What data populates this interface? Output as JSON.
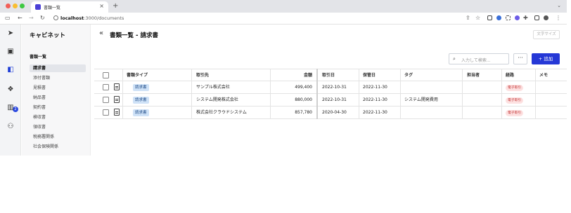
{
  "browser": {
    "tab_title": "書類一覧",
    "url_host": "localhost",
    "url_rest": ":3000/documents"
  },
  "colors": {
    "accent": "#2538d6",
    "tag_type_bg": "#cfe2f7",
    "tag_status_bg": "#fde1e1"
  },
  "sidebar": {
    "app_title": "キャビネット",
    "section_label": "書類一覧",
    "items": [
      {
        "label": "請求書",
        "active": true
      },
      {
        "label": "添付書類"
      },
      {
        "label": "見積書"
      },
      {
        "label": "納品書"
      },
      {
        "label": "契約書"
      },
      {
        "label": "検収書"
      },
      {
        "label": "領収書"
      },
      {
        "label": "税務署関係"
      },
      {
        "label": "社会保険関係"
      }
    ],
    "rail_badge": "2"
  },
  "main": {
    "title": "書類一覧 - 請求書",
    "font_size_button": "文字サイズ",
    "search_placeholder": "入力して検索...",
    "more_label": "···",
    "add_label": "+ 追加"
  },
  "table": {
    "columns": [
      "書類タイプ",
      "取引先",
      "金額",
      "取引日",
      "保管日",
      "タグ",
      "担当者",
      "経路",
      "メモ"
    ],
    "rows": [
      {
        "type": "請求書",
        "partner": "サンプル株式会社",
        "amount": "499,400",
        "deal_date": "2022-10-31",
        "store_date": "2022-11-30",
        "tag": "",
        "owner": "",
        "route": "電子取引",
        "memo": ""
      },
      {
        "type": "請求書",
        "partner": "システム開発株式会社",
        "amount": "880,000",
        "deal_date": "2022-10-31",
        "store_date": "2022-11-30",
        "tag": "システム開発費用",
        "owner": "",
        "route": "電子取引",
        "memo": ""
      },
      {
        "type": "請求書",
        "partner": "株式会社クラウドシステム",
        "amount": "857,780",
        "deal_date": "2020-04-30",
        "store_date": "2022-11-30",
        "tag": "",
        "owner": "",
        "route": "電子取引",
        "memo": ""
      }
    ]
  }
}
